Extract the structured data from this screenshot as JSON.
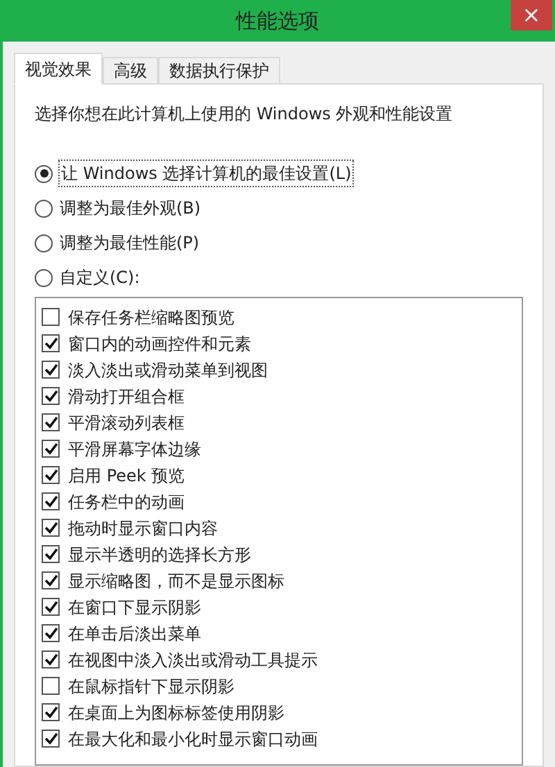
{
  "window": {
    "title": "性能选项",
    "close": "×"
  },
  "tabs": [
    {
      "label": "视觉效果",
      "selected": true
    },
    {
      "label": "高级",
      "selected": false
    },
    {
      "label": "数据执行保护",
      "selected": false
    }
  ],
  "description": "选择你想在此计算机上使用的 Windows 外观和性能设置",
  "options": [
    {
      "label": "让 Windows 选择计算机的最佳设置(L)",
      "selected": true
    },
    {
      "label": "调整为最佳外观(B)",
      "selected": false
    },
    {
      "label": "调整为最佳性能(P)",
      "selected": false
    },
    {
      "label": "自定义(C):",
      "selected": false
    }
  ],
  "effects": [
    {
      "label": "保存任务栏缩略图预览",
      "checked": false
    },
    {
      "label": "窗口内的动画控件和元素",
      "checked": true
    },
    {
      "label": "淡入淡出或滑动菜单到视图",
      "checked": true
    },
    {
      "label": "滑动打开组合框",
      "checked": true
    },
    {
      "label": "平滑滚动列表框",
      "checked": true
    },
    {
      "label": "平滑屏幕字体边缘",
      "checked": true
    },
    {
      "label": "启用 Peek 预览",
      "checked": true
    },
    {
      "label": "任务栏中的动画",
      "checked": true
    },
    {
      "label": "拖动时显示窗口内容",
      "checked": true
    },
    {
      "label": "显示半透明的选择长方形",
      "checked": true
    },
    {
      "label": "显示缩略图，而不是显示图标",
      "checked": true
    },
    {
      "label": "在窗口下显示阴影",
      "checked": true
    },
    {
      "label": "在单击后淡出菜单",
      "checked": true
    },
    {
      "label": "在视图中淡入淡出或滑动工具提示",
      "checked": true
    },
    {
      "label": "在鼠标指针下显示阴影",
      "checked": false
    },
    {
      "label": "在桌面上为图标标签使用阴影",
      "checked": true
    },
    {
      "label": "在最大化和最小化时显示窗口动画",
      "checked": true
    }
  ]
}
